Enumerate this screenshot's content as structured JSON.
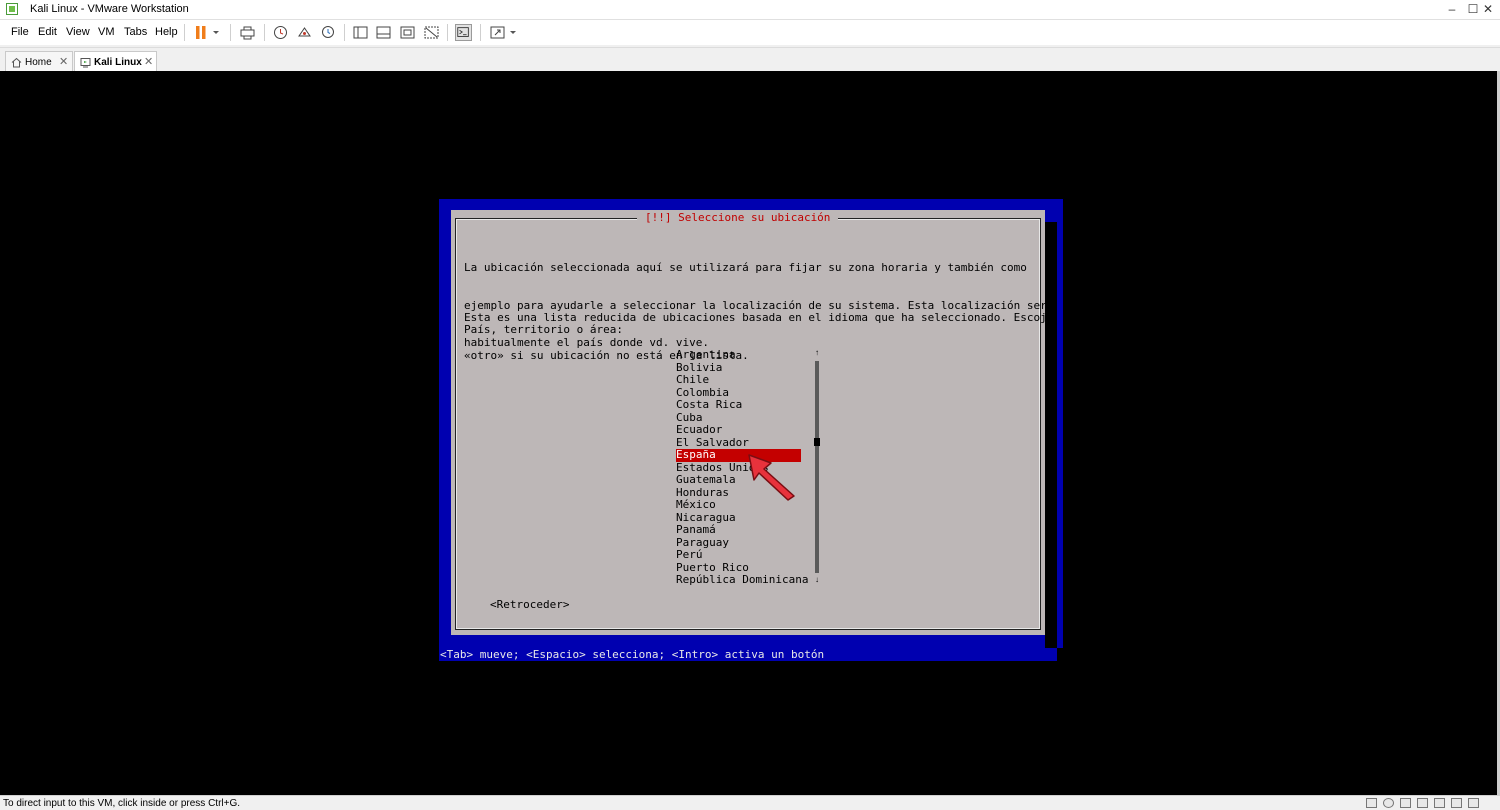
{
  "window": {
    "title": "Kali Linux - VMware Workstation",
    "minimize": "‒",
    "maximize": "☐",
    "close": "✕"
  },
  "menu": {
    "items": [
      "File",
      "Edit",
      "View",
      "VM",
      "Tabs",
      "Help"
    ]
  },
  "tabs": [
    {
      "label": "Home",
      "close": "✕"
    },
    {
      "label": "Kali Linux",
      "close": "✕"
    }
  ],
  "installer": {
    "dialog_title": "[!!] Seleccione su ubicación",
    "paragraph1": [
      "La ubicación seleccionada aquí se utilizará para fijar su zona horaria y también como",
      "ejemplo para ayudarle a seleccionar la localización de su sistema. Esta localización será",
      "habitualmente el país donde vd. vive."
    ],
    "paragraph2": [
      "Esta es una lista reducida de ubicaciones basada en el idioma que ha seleccionado. Escoja",
      "«otro» si su ubicación no está en la lista."
    ],
    "prompt": "País, territorio o área:",
    "countries": [
      "Argentina",
      "Bolivia",
      "Chile",
      "Colombia",
      "Costa Rica",
      "Cuba",
      "Ecuador",
      "El Salvador",
      "España",
      "Estados Unidos",
      "Guatemala",
      "Honduras",
      "México",
      "Nicaragua",
      "Panamá",
      "Paraguay",
      "Perú",
      "Puerto Rico",
      "República Dominicana"
    ],
    "selected": "España",
    "scroll_up": "↑",
    "scroll_down": "↓",
    "back_button": "<Retroceder>",
    "help_line": "<Tab> mueve; <Espacio> selecciona; <Intro> activa un botón"
  },
  "status": {
    "text": "To direct input to this VM, click inside or press Ctrl+G."
  },
  "colors": {
    "installer_blue": "#0000b0",
    "dialog_gray": "#bdb7b7",
    "selection_red": "#c40000",
    "title_red": "#c00000"
  }
}
